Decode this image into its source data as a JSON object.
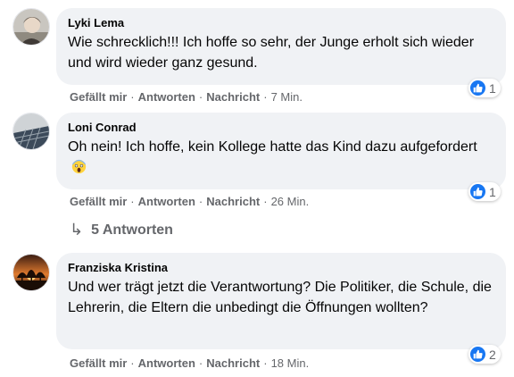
{
  "comments": [
    {
      "author": "Lyki Lema",
      "text": "Wie schrecklich!!! Ich hoffe so sehr, der Junge erholt sich wieder und wird wieder ganz gesund.",
      "like_label": "Gefällt mir",
      "reply_label": "Antworten",
      "message_label": "Nachricht",
      "time": "7 Min.",
      "reaction_icon": "like-icon",
      "reaction_count": "1"
    },
    {
      "author": "Loni Conrad",
      "text": "Oh nein! Ich hoffe, kein Kollege hatte das Kind dazu aufgefordert",
      "emoji": "screaming-face-emoji",
      "like_label": "Gefällt mir",
      "reply_label": "Antworten",
      "message_label": "Nachricht",
      "time": "26 Min.",
      "reaction_icon": "like-icon",
      "reaction_count": "1"
    },
    {
      "author": "Franziska Kristina",
      "text": "Und wer trägt jetzt die Verantwortung? Die Politiker, die Schule, die Lehrerin, die Eltern die unbedingt die Öffnungen wollten?",
      "like_label": "Gefällt mir",
      "reply_label": "Antworten",
      "message_label": "Nachricht",
      "time": "18 Min.",
      "reaction_icon": "like-icon",
      "reaction_count": "2"
    }
  ],
  "replies_link": {
    "icon": "reply-arrow-icon",
    "label": "5 Antworten"
  },
  "colors": {
    "bubble": "#f0f2f5",
    "meta_text": "#65676b",
    "like_blue": "#1877f2"
  }
}
